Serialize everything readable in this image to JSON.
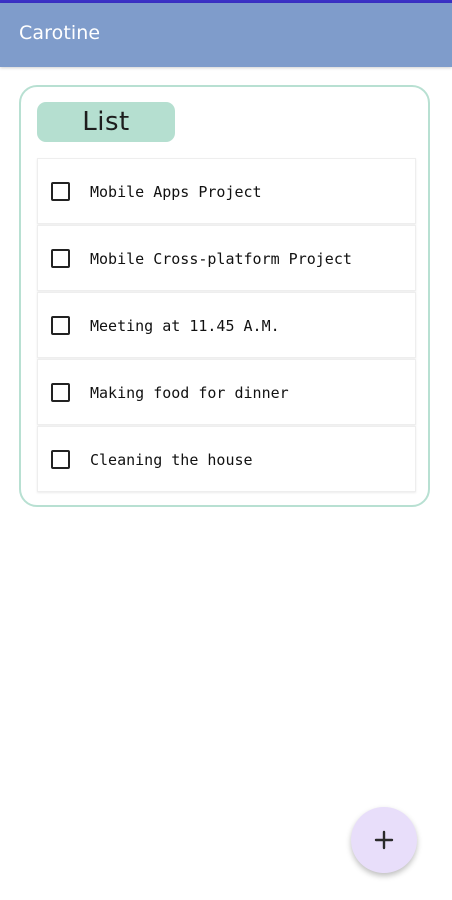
{
  "app_bar": {
    "title": "Carotine"
  },
  "card": {
    "heading": "List",
    "items": [
      {
        "label": "Mobile Apps Project",
        "checked": false
      },
      {
        "label": "Mobile Cross-platform Project",
        "checked": false
      },
      {
        "label": "Meeting at 11.45 A.M.",
        "checked": false
      },
      {
        "label": "Making food for dinner",
        "checked": false
      },
      {
        "label": "Cleaning the house",
        "checked": false
      }
    ]
  },
  "fab": {
    "icon": "plus-icon"
  },
  "colors": {
    "status_line": "#3b31c6",
    "app_bar": "#7f9ccb",
    "card_border": "#b8e0d2",
    "chip": "#b5dfd0",
    "fab": "#e8defa"
  }
}
